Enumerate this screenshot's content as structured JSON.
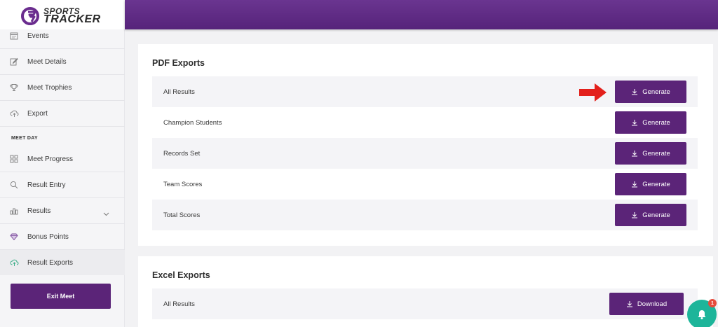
{
  "logo": {
    "line1": "SPORTS",
    "line2": "TRACKER"
  },
  "sidebar": {
    "items": [
      {
        "label": "Events",
        "icon": "calendar-icon"
      },
      {
        "label": "Meet Details",
        "icon": "edit-icon"
      },
      {
        "label": "Meet Trophies",
        "icon": "trophy-icon"
      },
      {
        "label": "Export",
        "icon": "cloud-upload-icon"
      },
      {
        "label": "Meet Progress",
        "icon": "grid-icon"
      },
      {
        "label": "Result Entry",
        "icon": "search-icon"
      },
      {
        "label": "Results",
        "icon": "bar-chart-icon"
      },
      {
        "label": "Bonus Points",
        "icon": "diamond-icon"
      },
      {
        "label": "Result Exports",
        "icon": "cloud-upload-icon"
      }
    ],
    "section_label": "MEET DAY",
    "exit_label": "Exit Meet"
  },
  "pdf_exports": {
    "title": "PDF Exports",
    "button_label": "Generate",
    "rows": [
      "All Results",
      "Champion Students",
      "Records Set",
      "Team Scores",
      "Total Scores"
    ]
  },
  "excel_exports": {
    "title": "Excel Exports",
    "button_label": "Download",
    "rows": [
      "All Results"
    ]
  },
  "notifications": {
    "count": "1"
  },
  "colors": {
    "accent": "#5b2478",
    "topbar": "#5e2a7e",
    "bell": "#1db59a",
    "arrow": "#e3201b"
  }
}
